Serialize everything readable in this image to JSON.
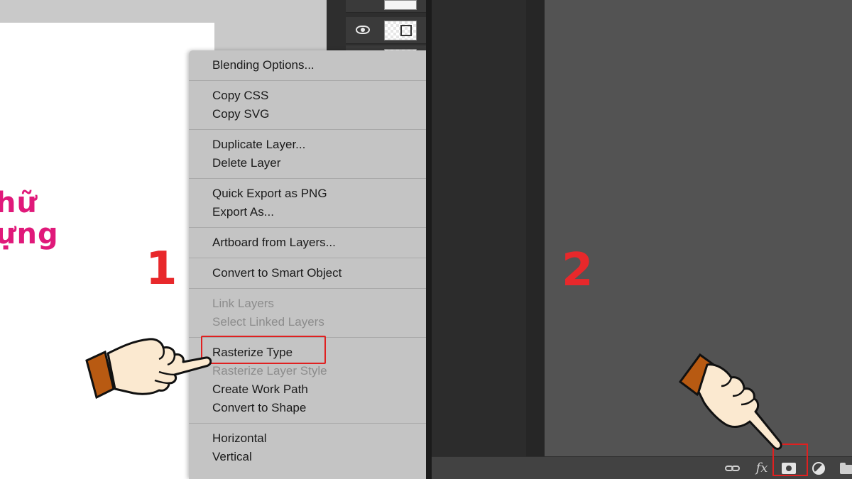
{
  "left_panel": {
    "step_label": "1",
    "artboard_text": [
      "hữ",
      "ựng"
    ],
    "context_menu": {
      "groups": [
        {
          "items": [
            {
              "label": "Blending Options...",
              "enabled": true
            }
          ]
        },
        {
          "items": [
            {
              "label": "Copy CSS",
              "enabled": true
            },
            {
              "label": "Copy SVG",
              "enabled": true
            }
          ]
        },
        {
          "items": [
            {
              "label": "Duplicate Layer...",
              "enabled": true
            },
            {
              "label": "Delete Layer",
              "enabled": true
            }
          ]
        },
        {
          "items": [
            {
              "label": "Quick Export as PNG",
              "enabled": true
            },
            {
              "label": "Export As...",
              "enabled": true
            }
          ]
        },
        {
          "items": [
            {
              "label": "Artboard from Layers...",
              "enabled": true
            }
          ]
        },
        {
          "items": [
            {
              "label": "Convert to Smart Object",
              "enabled": true
            }
          ]
        },
        {
          "items": [
            {
              "label": "Link Layers",
              "enabled": false
            },
            {
              "label": "Select Linked Layers",
              "enabled": false
            }
          ]
        },
        {
          "items": [
            {
              "label": "Rasterize Type",
              "enabled": true,
              "highlighted": true
            },
            {
              "label": "Rasterize Layer Style",
              "enabled": false
            },
            {
              "label": "Create Work Path",
              "enabled": true
            },
            {
              "label": "Convert to Shape",
              "enabled": true
            }
          ]
        },
        {
          "items": [
            {
              "label": "Horizontal",
              "enabled": true
            },
            {
              "label": "Vertical",
              "enabled": true
            }
          ]
        }
      ]
    },
    "highlight_color": "#e02020",
    "text_color": "#e0197a"
  },
  "right_panel": {
    "step_label": "2",
    "bottom_bar_icons": [
      "link-icon",
      "fx-icon",
      "add-layer-mask-icon",
      "adjustment-layer-icon",
      "folder-icon"
    ],
    "fx_label": "fx",
    "highlighted_icon": "add-layer-mask-icon"
  },
  "colors": {
    "step_number": "#e8282b",
    "menu_bg": "#c4c4c4",
    "layers_panel_bg": "#535353"
  }
}
